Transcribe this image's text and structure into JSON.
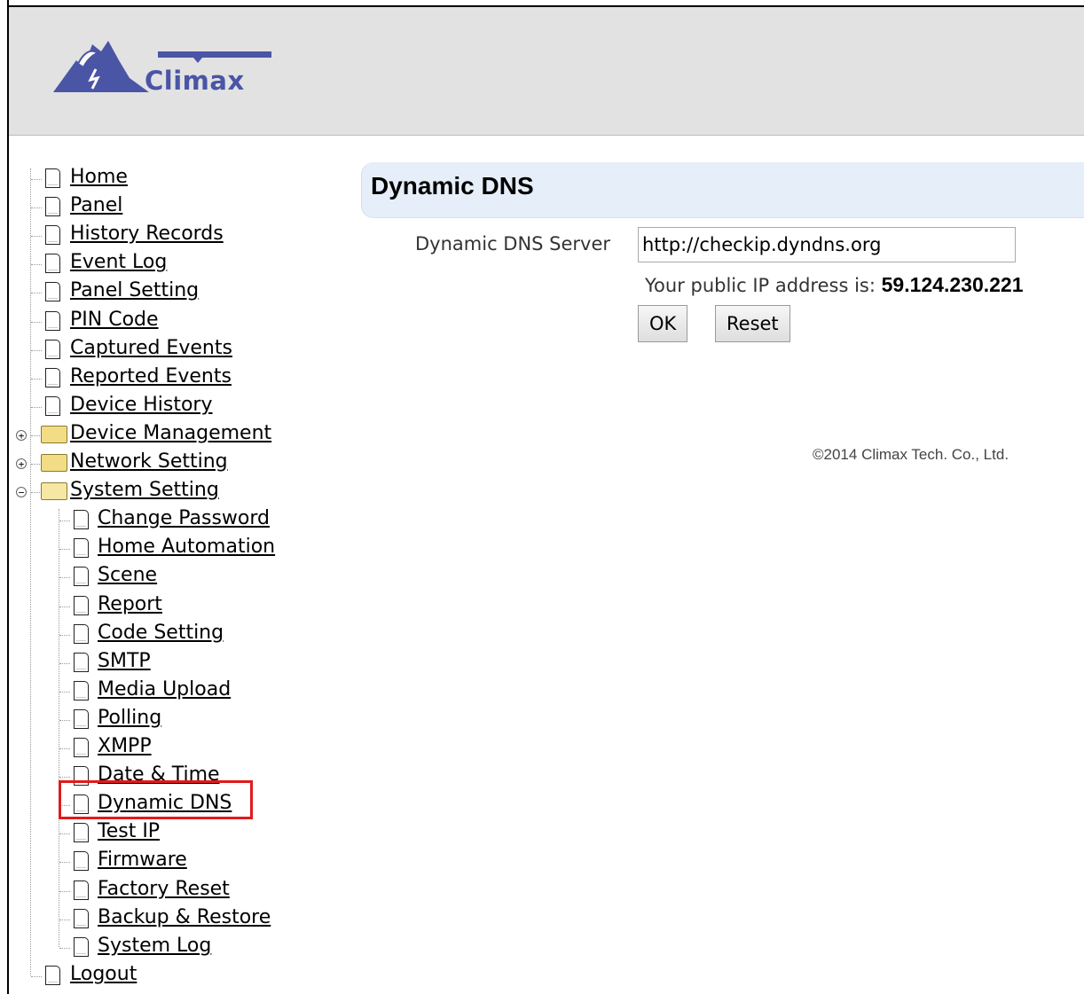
{
  "header": {
    "logo_text": "Climax"
  },
  "nav": {
    "top_items": [
      "Home",
      "Panel",
      "History Records",
      "Event Log",
      "Panel Setting",
      "PIN Code",
      "Captured Events",
      "Reported Events",
      "Device History"
    ],
    "folders": [
      "Device Management",
      "Network Setting",
      "System Setting"
    ],
    "system_items": [
      "Change Password",
      "Home Automation",
      "Scene",
      "Report",
      "Code Setting",
      "SMTP",
      "Media Upload",
      "Polling",
      "XMPP",
      "Date & Time",
      "Dynamic DNS",
      "Test IP",
      "Firmware",
      "Factory Reset",
      "Backup & Restore",
      "System Log"
    ],
    "logout": "Logout"
  },
  "main": {
    "title": "Dynamic DNS",
    "server_label": "Dynamic DNS Server",
    "server_value": "http://checkip.dyndns.org",
    "ip_label": "Your public IP address is:",
    "ip_value": "59.124.230.221",
    "ok_label": "OK",
    "reset_label": "Reset"
  },
  "footer": {
    "copyright": "©2014 Climax Tech. Co., Ltd."
  },
  "colors": {
    "header_bg": "#e2e2e2",
    "title_bar_bg": "#e6eef9",
    "highlight": "#e01b1b",
    "logo_blue": "#4a55a6"
  }
}
